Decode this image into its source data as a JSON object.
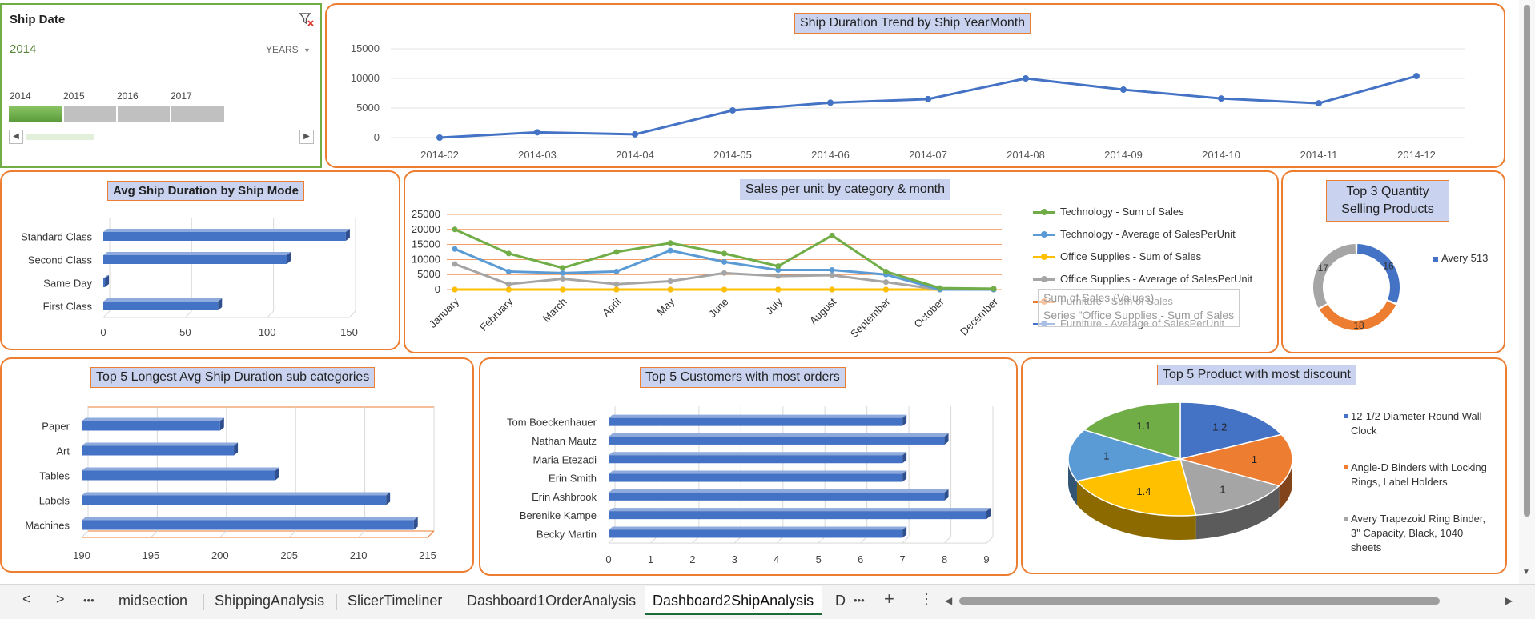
{
  "slicer": {
    "title": "Ship Date",
    "selected": "2014",
    "level": "YEARS",
    "years": [
      "2014",
      "2015",
      "2016",
      "2017"
    ],
    "selected_fraction": 0.25
  },
  "trend": {
    "title": "Ship Duration Trend by Ship YearMonth",
    "chart_data": {
      "type": "line",
      "x": [
        "2014-02",
        "2014-03",
        "2014-04",
        "2014-05",
        "2014-06",
        "2014-07",
        "2014-08",
        "2014-09",
        "2014-10",
        "2014-11",
        "2014-12"
      ],
      "values": [
        0,
        900,
        550,
        4600,
        5900,
        6500,
        10000,
        8100,
        6600,
        5800,
        10400
      ],
      "yticks": [
        "0",
        "5000",
        "10000",
        "15000"
      ],
      "ylim": [
        0,
        15000
      ],
      "color": "#4472c4"
    }
  },
  "shipmode": {
    "title": "Avg Ship Duration by Ship Mode",
    "chart_data": {
      "type": "bar",
      "categories": [
        "Standard Class",
        "Second Class",
        "Same Day",
        "First Class"
      ],
      "values": [
        148,
        112,
        1,
        70
      ],
      "xticks": [
        "0",
        "50",
        "100",
        "150"
      ],
      "xlim": [
        0,
        150
      ]
    }
  },
  "sales": {
    "title": "Sales per unit by category & month",
    "chart_data": {
      "type": "line",
      "categories": [
        "January",
        "February",
        "March",
        "April",
        "May",
        "June",
        "July",
        "August",
        "September",
        "October",
        "December"
      ],
      "yticks": [
        "0",
        "5000",
        "10000",
        "15000",
        "20000",
        "25000"
      ],
      "ylim": [
        0,
        25000
      ],
      "series": [
        {
          "name": "Technology - Sum of Sales",
          "color": "#70ad47",
          "values": [
            20000,
            12000,
            7200,
            12500,
            15500,
            12000,
            7800,
            18000,
            6000,
            500,
            300
          ]
        },
        {
          "name": "Technology - Average of SalesPerUnit",
          "color": "#5b9bd5",
          "values": [
            13500,
            6000,
            5500,
            6000,
            13000,
            9200,
            6500,
            6500,
            5000,
            0,
            0
          ]
        },
        {
          "name": "Office Supplies - Sum of Sales",
          "color": "#ffc000",
          "values": [
            0,
            0,
            0,
            0,
            0,
            0,
            0,
            0,
            0,
            0,
            0
          ]
        },
        {
          "name": "Office Supplies - Average of SalesPerUnit",
          "color": "#a5a5a5",
          "values": [
            8500,
            1800,
            3600,
            1800,
            2800,
            5500,
            4500,
            4800,
            2500,
            0,
            0
          ]
        },
        {
          "name": "Furniture - Sum of Sales",
          "color": "#ed7d31",
          "values": [
            0,
            0,
            0,
            0,
            0,
            0,
            0,
            0,
            0,
            0,
            0
          ]
        },
        {
          "name": "Furniture - Average of SalesPerUnit",
          "color": "#4472c4",
          "values": [
            0,
            0,
            0,
            0,
            0,
            0,
            0,
            0,
            0,
            0,
            0
          ]
        }
      ]
    },
    "tooltip_line1": "Sum of Sales (Values)",
    "tooltip_line2": "Series \"Office Supplies - Sum of Sales"
  },
  "top3": {
    "title": "Top 3 Quantity Selling Products",
    "chart_data": {
      "type": "pie",
      "labels": [
        "16",
        "18",
        "17"
      ],
      "values": [
        16,
        18,
        17
      ],
      "colors": [
        "#4472c4",
        "#ed7d31",
        "#a5a5a5"
      ]
    },
    "legend": "Avery 513"
  },
  "subcats": {
    "title": "Top 5 Longest Avg Ship Duration sub categories",
    "chart_data": {
      "type": "bar",
      "categories": [
        "Paper",
        "Art",
        "Tables",
        "Labels",
        "Machines"
      ],
      "values": [
        200,
        201,
        204,
        212,
        214
      ],
      "xticks": [
        "190",
        "195",
        "200",
        "205",
        "210",
        "215"
      ],
      "xlim": [
        190,
        215
      ]
    }
  },
  "customers": {
    "title": "Top 5 Customers with most orders",
    "chart_data": {
      "type": "bar",
      "categories": [
        "Tom Boeckenhauer",
        "Nathan Mautz",
        "Maria Etezadi",
        "Erin Smith",
        "Erin Ashbrook",
        "Berenike Kampe",
        "Becky Martin"
      ],
      "values": [
        7,
        8,
        7,
        7,
        8,
        9,
        7
      ],
      "xticks": [
        "0",
        "1",
        "2",
        "3",
        "4",
        "5",
        "6",
        "7",
        "8",
        "9"
      ],
      "xlim": [
        0,
        9
      ]
    }
  },
  "discount": {
    "title": "Top 5 Product with most discount",
    "chart_data": {
      "type": "pie",
      "labels": [
        "1.2",
        "1",
        "1",
        "1.4",
        "1",
        "1.1"
      ],
      "values": [
        1.2,
        1,
        1,
        1.4,
        1,
        1.1
      ],
      "colors": [
        "#4472c4",
        "#ed7d31",
        "#a5a5a5",
        "#ffc000",
        "#5b9bd5",
        "#70ad47"
      ]
    },
    "legend": [
      {
        "line1": "12-1/2 Diameter Round Wall",
        "line2": "Clock",
        "line3": "",
        "color": "#4472c4"
      },
      {
        "line1": "Angle-D Binders with Locking",
        "line2": "Rings, Label Holders",
        "line3": "",
        "color": "#ed7d31"
      },
      {
        "line1": "Avery Trapezoid Ring Binder,",
        "line2": "3\" Capacity, Black, 1040",
        "line3": "sheets",
        "color": "#a5a5a5"
      }
    ]
  },
  "tabs": {
    "items": [
      "midsection",
      "ShippingAnalysis",
      "SlicerTimeliner",
      "Dashboard1OrderAnalysis",
      "Dashboard2ShipAnalysis",
      "D"
    ],
    "active": "Dashboard2ShipAnalysis",
    "prev": "<",
    "next": ">",
    "more": "•••",
    "add": "+",
    "menu": "⋮"
  }
}
